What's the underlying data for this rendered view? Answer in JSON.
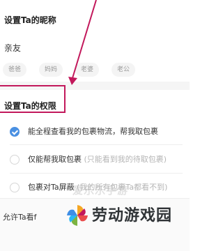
{
  "nickname": {
    "title": "设置Ta的昵称",
    "value": "亲友",
    "suggestions": [
      "爸爸",
      "妈妈",
      "老婆",
      "老公"
    ]
  },
  "permissions": {
    "title": "设置Ta的权限",
    "options": [
      {
        "label": "能全程查看我的包裹物流，帮我取包裹",
        "sub": "",
        "checked": true
      },
      {
        "label": "仅能帮我取包裹",
        "sub": "(只能看到我的待取包裹)",
        "checked": false
      },
      {
        "label": "包裹对Ta屏蔽",
        "sub": "(我的所有包裹Ta都看不到)",
        "checked": false
      }
    ]
  },
  "allow": {
    "label": "允许Ta看f"
  },
  "watermark": {
    "faint_text": "爱乐乐手游",
    "logo_text": "劳动游戏园"
  },
  "annotation_color": "#c2185b",
  "accent_color": "#4a90e2"
}
